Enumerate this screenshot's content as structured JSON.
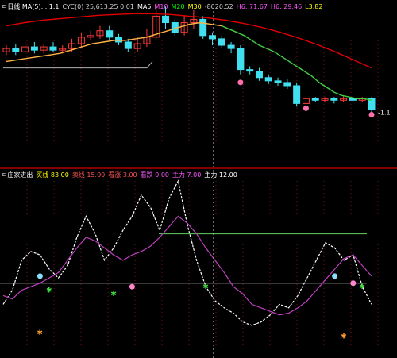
{
  "top_header": [
    {
      "text": "ㅁ日线 MA(5)... 1.1",
      "color": "#ffffff"
    },
    {
      "text": "CYC(0) 25,613.25 0.01",
      "color": "#cfcfcf"
    },
    {
      "text": "MA5",
      "color": "#ffffff"
    },
    {
      "text": "M10",
      "color": "#ff55ff"
    },
    {
      "text": "M20",
      "color": "#00ff00"
    },
    {
      "text": "M30",
      "color": "#ffff00"
    },
    {
      "text": "-8020.52",
      "color": "#cfcfcf"
    },
    {
      "text": "H6: 71.67",
      "color": "#ff55ff"
    },
    {
      "text": "H6: 29.46",
      "color": "#ff55ff"
    },
    {
      "text": "L3.82",
      "color": "#ffff00"
    }
  ],
  "bottom_header": [
    {
      "text": "ㅁ庄家进出",
      "color": "#ffffff"
    },
    {
      "text": "买线 83.00",
      "color": "#ffff00"
    },
    {
      "text": "卖线 15.00",
      "color": "#ff5555"
    },
    {
      "text": "看涨 3.00",
      "color": "#ff5555"
    },
    {
      "text": "看跌 0.00",
      "color": "#ff55ff"
    },
    {
      "text": "主力 7.00",
      "color": "#ff55ff"
    },
    {
      "text": "主力 12.00",
      "color": "#ffffff"
    }
  ],
  "colors": {
    "background": "#000000",
    "divider": "#b00000",
    "up_candle": "#ff3b3b",
    "down_candle": "#40e0f0",
    "ma_long": "#e00000",
    "ma_orange": "#ffb347",
    "ma_green": "#40d040",
    "support": "#b0b0b0",
    "osc_white": "#ffffff",
    "osc_purple": "#c040c0",
    "ref_green": "#60d060",
    "ref_white": "#e0e0e0",
    "cursor": "#d0d0d0"
  },
  "chart_data": [
    {
      "type": "candlestick",
      "title": "",
      "ylim": [
        0,
        100
      ],
      "candles": [
        {
          "x": 1,
          "o": 76,
          "c": 78,
          "h": 80,
          "l": 74
        },
        {
          "x": 2,
          "o": 78,
          "c": 76,
          "h": 81,
          "l": 74
        },
        {
          "x": 3,
          "o": 76,
          "c": 79,
          "h": 82,
          "l": 75
        },
        {
          "x": 4,
          "o": 79,
          "c": 77,
          "h": 82,
          "l": 75
        },
        {
          "x": 5,
          "o": 77,
          "c": 79,
          "h": 81,
          "l": 75
        },
        {
          "x": 6,
          "o": 79,
          "c": 77,
          "h": 82,
          "l": 76
        },
        {
          "x": 7,
          "o": 77,
          "c": 78,
          "h": 80,
          "l": 75
        },
        {
          "x": 8,
          "o": 78,
          "c": 81,
          "h": 84,
          "l": 76
        },
        {
          "x": 9,
          "o": 81,
          "c": 85,
          "h": 88,
          "l": 79
        },
        {
          "x": 10,
          "o": 85,
          "c": 86,
          "h": 89,
          "l": 83
        },
        {
          "x": 11,
          "o": 86,
          "c": 89,
          "h": 92,
          "l": 84
        },
        {
          "x": 12,
          "o": 89,
          "c": 85,
          "h": 92,
          "l": 83
        },
        {
          "x": 13,
          "o": 85,
          "c": 82,
          "h": 87,
          "l": 80
        },
        {
          "x": 14,
          "o": 82,
          "c": 78,
          "h": 84,
          "l": 76
        },
        {
          "x": 15,
          "o": 78,
          "c": 81,
          "h": 85,
          "l": 76
        },
        {
          "x": 16,
          "o": 81,
          "c": 85,
          "h": 90,
          "l": 79
        },
        {
          "x": 17,
          "o": 85,
          "c": 98,
          "h": 106,
          "l": 84
        },
        {
          "x": 18,
          "o": 98,
          "c": 94,
          "h": 104,
          "l": 90
        },
        {
          "x": 19,
          "o": 94,
          "c": 88,
          "h": 96,
          "l": 86
        },
        {
          "x": 20,
          "o": 88,
          "c": 94,
          "h": 98,
          "l": 86
        },
        {
          "x": 21,
          "o": 94,
          "c": 96,
          "h": 102,
          "l": 90
        },
        {
          "x": 22,
          "o": 96,
          "c": 86,
          "h": 98,
          "l": 84
        },
        {
          "x": 23,
          "o": 86,
          "c": 84,
          "h": 88,
          "l": 80
        },
        {
          "x": 24,
          "o": 84,
          "c": 80,
          "h": 86,
          "l": 78
        },
        {
          "x": 25,
          "o": 80,
          "c": 78,
          "h": 82,
          "l": 75
        },
        {
          "x": 26,
          "o": 78,
          "c": 65,
          "h": 80,
          "l": 62
        },
        {
          "x": 27,
          "o": 65,
          "c": 64,
          "h": 67,
          "l": 62
        },
        {
          "x": 28,
          "o": 64,
          "c": 60,
          "h": 66,
          "l": 58
        },
        {
          "x": 29,
          "o": 60,
          "c": 58,
          "h": 62,
          "l": 56
        },
        {
          "x": 30,
          "o": 58,
          "c": 57,
          "h": 60,
          "l": 55
        },
        {
          "x": 31,
          "o": 57,
          "c": 55,
          "h": 59,
          "l": 53
        },
        {
          "x": 32,
          "o": 55,
          "c": 44,
          "h": 57,
          "l": 42
        },
        {
          "x": 33,
          "o": 44,
          "c": 47,
          "h": 49,
          "l": 42
        },
        {
          "x": 34,
          "o": 47,
          "c": 46,
          "h": 48,
          "l": 45
        },
        {
          "x": 35,
          "o": 46,
          "c": 47,
          "h": 48,
          "l": 45
        },
        {
          "x": 36,
          "o": 47,
          "c": 46,
          "h": 48,
          "l": 44
        },
        {
          "x": 37,
          "o": 46,
          "c": 47,
          "h": 49,
          "l": 45
        },
        {
          "x": 38,
          "o": 47,
          "c": 46,
          "h": 48,
          "l": 45
        },
        {
          "x": 39,
          "o": 46,
          "c": 47,
          "h": 48,
          "l": 45
        },
        {
          "x": 40,
          "o": 47,
          "c": 40,
          "h": 48,
          "l": 38
        }
      ],
      "series": [
        {
          "values": [
            92,
            94,
            95.5,
            96.5,
            97.5,
            98.5,
            99,
            99.5,
            99.5,
            99,
            98,
            97,
            95.5,
            93.5,
            91,
            88,
            84.5,
            80.5,
            76,
            71,
            66
          ]
        },
        {
          "values": [
            70,
            71,
            72,
            73,
            74,
            75,
            77,
            79,
            81,
            82,
            83,
            83,
            84,
            85,
            87,
            89,
            91,
            93,
            94,
            93,
            92
          ]
        },
        {
          "values": [
            92,
            90,
            88,
            86,
            83,
            80,
            78,
            76,
            73,
            70,
            67,
            64,
            61,
            57,
            54,
            51,
            49,
            48,
            47,
            47,
            46
          ]
        }
      ],
      "support_level": 66,
      "markers": [
        {
          "x": 26,
          "y": 59,
          "color": "#ff6fae"
        },
        {
          "x": 33,
          "y": 43,
          "color": "#ff6fae"
        },
        {
          "x": 40,
          "y": 39,
          "color": "#ff6fae"
        }
      ],
      "last_value": "-1.1"
    },
    {
      "type": "line",
      "title": "",
      "ylim": [
        0,
        100
      ],
      "series": [
        {
          "values": [
            30,
            38,
            55,
            60,
            58,
            50,
            45,
            52,
            68,
            80,
            70,
            55,
            62,
            72,
            80,
            92,
            85,
            72,
            90,
            100,
            75,
            55,
            40,
            32,
            28,
            25,
            20,
            18,
            20,
            24,
            30,
            28,
            35,
            45,
            55,
            65,
            62,
            55,
            58,
            40,
            30
          ]
        },
        {
          "values": [
            35,
            33,
            38,
            40,
            42,
            45,
            48,
            55,
            62,
            68,
            66,
            62,
            58,
            55,
            58,
            60,
            63,
            68,
            74,
            80,
            76,
            70,
            62,
            55,
            48,
            40,
            36,
            30,
            28,
            26,
            24,
            25,
            28,
            32,
            38,
            44,
            50,
            56,
            58,
            52,
            46
          ]
        }
      ],
      "reference_lines": [
        {
          "value": 70,
          "label": "",
          "color": "#60d060"
        },
        {
          "value": 42,
          "label": "",
          "color": "#e0e0e0"
        }
      ],
      "markers": [
        {
          "x": 4,
          "y": 46,
          "kind": "dot",
          "color": "#88ddff"
        },
        {
          "x": 14,
          "y": 40,
          "kind": "dot",
          "color": "#ff88cc"
        },
        {
          "x": 36,
          "y": 46,
          "kind": "dot",
          "color": "#88ddff"
        },
        {
          "x": 38,
          "y": 42,
          "kind": "dot",
          "color": "#ff88cc"
        },
        {
          "x": 5,
          "y": 38,
          "kind": "star",
          "color": "#40e040"
        },
        {
          "x": 12,
          "y": 36,
          "kind": "star",
          "color": "#40e040"
        },
        {
          "x": 22,
          "y": 40,
          "kind": "star",
          "color": "#40e040"
        },
        {
          "x": 39,
          "y": 40,
          "kind": "star",
          "color": "#40e040"
        },
        {
          "x": 4,
          "y": 14,
          "kind": "star",
          "color": "#ffa030"
        },
        {
          "x": 37,
          "y": 12,
          "kind": "star",
          "color": "#ffa030"
        }
      ]
    }
  ]
}
